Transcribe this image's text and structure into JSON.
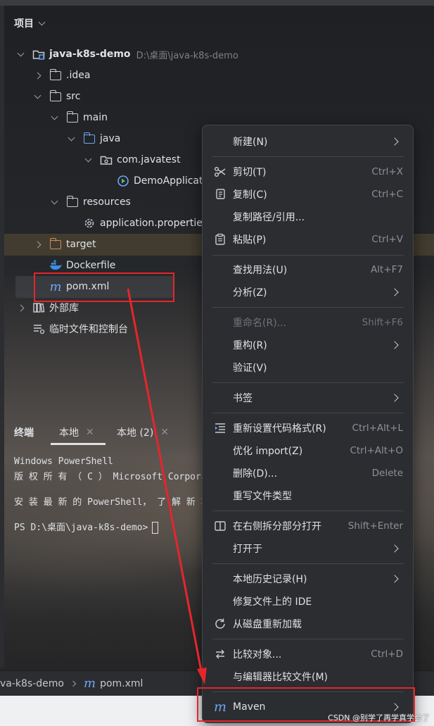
{
  "project_panel": {
    "title": "项目",
    "tree": [
      {
        "label": "java-k8s-demo",
        "path": "D:\\桌面\\java-k8s-demo"
      },
      {
        "label": ".idea"
      },
      {
        "label": "src"
      },
      {
        "label": "main"
      },
      {
        "label": "java"
      },
      {
        "label": "com.javatest"
      },
      {
        "label": "DemoApplicat"
      },
      {
        "label": "resources"
      },
      {
        "label": "application.properties"
      },
      {
        "label": "target"
      },
      {
        "label": "Dockerfile"
      },
      {
        "label": "pom.xml"
      },
      {
        "label": "外部库"
      },
      {
        "label": "临时文件和控制台"
      }
    ]
  },
  "terminal": {
    "title": "终端",
    "tabs": [
      {
        "label": "本地"
      },
      {
        "label": "本地 (2)"
      }
    ],
    "lines": [
      "Windows PowerShell",
      "版 权 所 有 （ C ） Microsoft Corporatio",
      "安 装 最 新 的 PowerShell， 了 解 新 功 能",
      "PS D:\\桌面\\java-k8s-demo>"
    ]
  },
  "breadcrumb": {
    "project": "va-k8s-demo",
    "file": "pom.xml"
  },
  "context_menu": {
    "items": [
      {
        "label": "新建(N)"
      },
      {
        "label": "剪切(T)",
        "shortcut": "Ctrl+X"
      },
      {
        "label": "复制(C)",
        "shortcut": "Ctrl+C"
      },
      {
        "label": "复制路径/引用..."
      },
      {
        "label": "粘贴(P)",
        "shortcut": "Ctrl+V"
      },
      {
        "label": "查找用法(U)",
        "shortcut": "Alt+F7"
      },
      {
        "label": "分析(Z)"
      },
      {
        "label": "重命名(R)...",
        "shortcut": "Shift+F6"
      },
      {
        "label": "重构(R)"
      },
      {
        "label": "验证(V)"
      },
      {
        "label": "书签"
      },
      {
        "label": "重新设置代码格式(R)",
        "shortcut": "Ctrl+Alt+L"
      },
      {
        "label": "优化 import(Z)",
        "shortcut": "Ctrl+Alt+O"
      },
      {
        "label": "删除(D)...",
        "shortcut": "Delete"
      },
      {
        "label": "重写文件类型"
      },
      {
        "label": "在右侧拆分部分打开",
        "shortcut": "Shift+Enter"
      },
      {
        "label": "打开于"
      },
      {
        "label": "本地历史记录(H)"
      },
      {
        "label": "修复文件上的 IDE"
      },
      {
        "label": "从磁盘重新加载"
      },
      {
        "label": "比较对象...",
        "shortcut": "Ctrl+D"
      },
      {
        "label": "与编辑器比较文件(M)"
      },
      {
        "label": "Maven"
      }
    ]
  },
  "watermark": "CSDN @别学了再学真学会了",
  "colors": {
    "accent_blue": "#6ea4f5",
    "annotation_red": "#e5262b",
    "menu_bg": "#2b2d30"
  }
}
